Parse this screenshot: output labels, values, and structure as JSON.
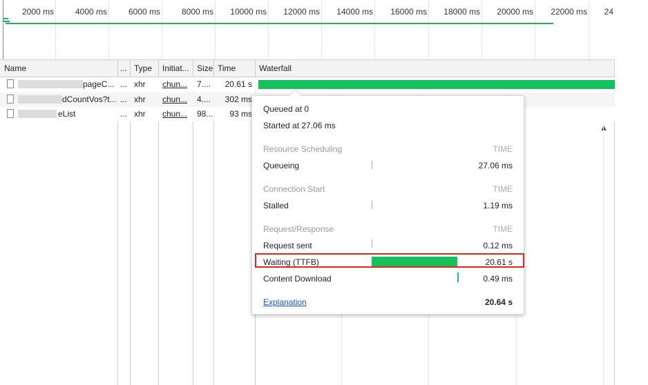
{
  "overview": {
    "ticks": [
      "2000 ms",
      "4000 ms",
      "6000 ms",
      "8000 ms",
      "10000 ms",
      "12000 ms",
      "14000 ms",
      "16000 ms",
      "18000 ms",
      "20000 ms",
      "22000 ms",
      "24"
    ]
  },
  "columns": {
    "name": "Name",
    "more": "...",
    "type": "Type",
    "initiator": "Initiat...",
    "size": "Size",
    "time": "Time",
    "waterfall": "Waterfall"
  },
  "rows": [
    {
      "name": "pageC...",
      "more": "...",
      "type": "xhr",
      "initiator": "chun...",
      "size": "7....",
      "time": "20.61 s"
    },
    {
      "name": "dCountVos?t...",
      "more": "...",
      "type": "xhr",
      "initiator": "chun...",
      "size": "4....",
      "time": "302 ms"
    },
    {
      "name": "eList",
      "more": "...",
      "type": "xhr",
      "initiator": "chun...",
      "size": "98...",
      "time": "93 ms"
    }
  ],
  "tooltip": {
    "queued": "Queued at 0",
    "started": "Started at 27.06 ms",
    "time_header": "TIME",
    "sections": {
      "resource_scheduling": "Resource Scheduling",
      "connection_start": "Connection Start",
      "request_response": "Request/Response"
    },
    "queueing": {
      "label": "Queueing",
      "value": "27.06 ms"
    },
    "stalled": {
      "label": "Stalled",
      "value": "1.19 ms"
    },
    "request_sent": {
      "label": "Request sent",
      "value": "0.12 ms"
    },
    "waiting": {
      "label": "Waiting (TTFB)",
      "value": "20.61 s"
    },
    "content_download": {
      "label": "Content Download",
      "value": "0.49 ms"
    },
    "explanation": "Explanation",
    "total": "20.64 s"
  },
  "colors": {
    "bar_green": "#14c15d",
    "highlight_red": "#e3251b",
    "download_blue": "#1fa2d8",
    "link_blue": "#1a56c4"
  }
}
